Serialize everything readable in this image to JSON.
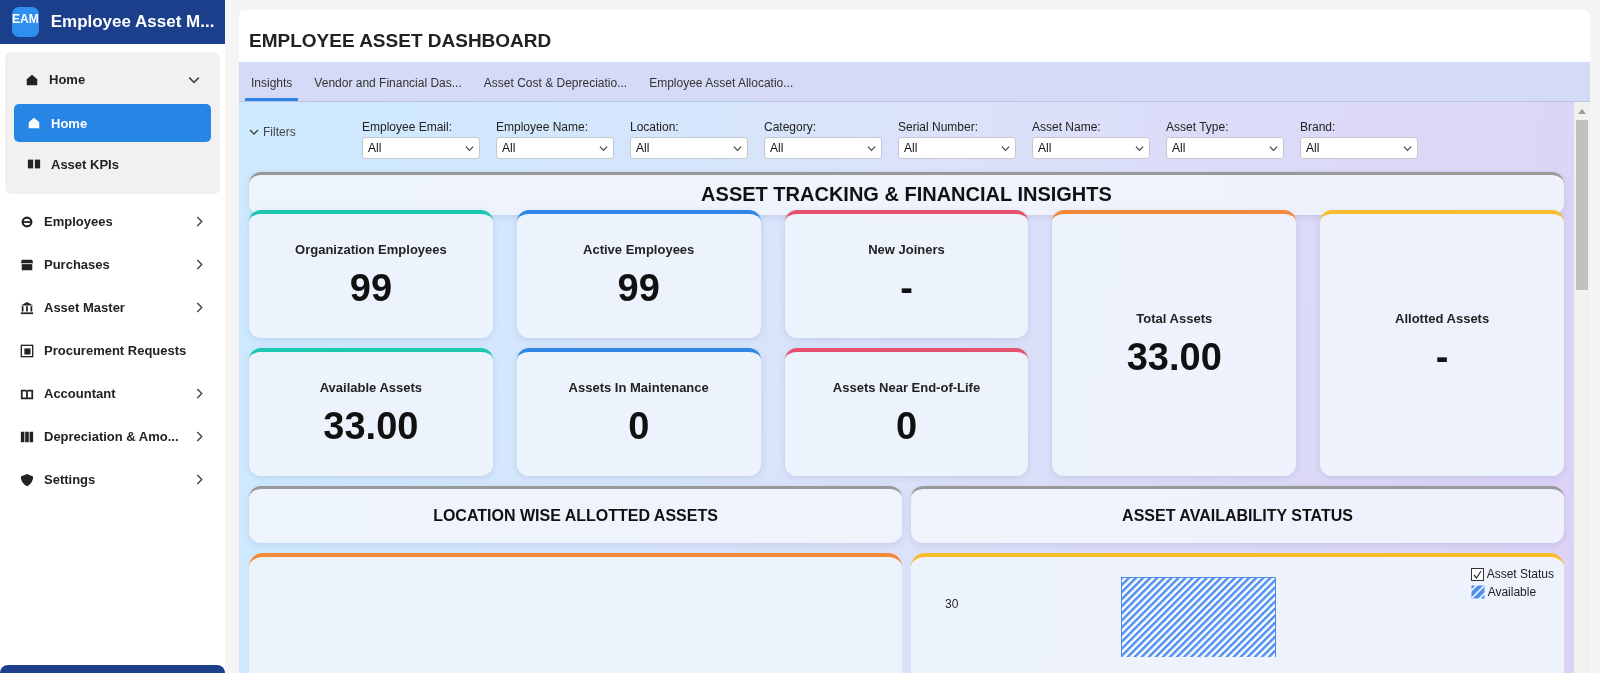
{
  "app": {
    "logo": "EAM",
    "title": "Employee Asset M..."
  },
  "sidebar": {
    "items": [
      {
        "label": "Home",
        "expanded": true,
        "children": [
          {
            "label": "Home",
            "selected": true
          },
          {
            "label": "Asset KPIs",
            "selected": false
          }
        ]
      },
      {
        "label": "Employees",
        "expanded": false
      },
      {
        "label": "Purchases",
        "expanded": false
      },
      {
        "label": "Asset Master",
        "expanded": false
      },
      {
        "label": "Procurement Requests"
      },
      {
        "label": "Accountant",
        "expanded": false
      },
      {
        "label": "Depreciation & Amo...",
        "expanded": false
      },
      {
        "label": "Settings",
        "expanded": false
      }
    ]
  },
  "page": {
    "title": "EMPLOYEE ASSET DASHBOARD"
  },
  "tabs": [
    {
      "label": "Insights",
      "selected": true
    },
    {
      "label": "Vendor and Financial Das...",
      "selected": false
    },
    {
      "label": "Asset Cost & Depreciatio...",
      "selected": false
    },
    {
      "label": "Employee Asset Allocatio...",
      "selected": false
    }
  ],
  "filters": {
    "toggle": "Filters",
    "expanded": true,
    "fields": [
      {
        "label": "Employee Email:",
        "value": "All"
      },
      {
        "label": "Employee Name:",
        "value": "All"
      },
      {
        "label": "Location:",
        "value": "All"
      },
      {
        "label": "Category:",
        "value": "All"
      },
      {
        "label": "Serial Number:",
        "value": "All"
      },
      {
        "label": "Asset Name:",
        "value": "All"
      },
      {
        "label": "Asset Type:",
        "value": "All"
      },
      {
        "label": "Brand:",
        "value": "All"
      }
    ]
  },
  "insights": {
    "title": "ASSET TRACKING & FINANCIAL INSIGHTS",
    "cards": [
      {
        "kind": "small",
        "label": "Organization Employees",
        "value": "99",
        "color": "#1cc7b0"
      },
      {
        "kind": "small",
        "label": "Active Employees",
        "value": "99",
        "color": "#2f86e6"
      },
      {
        "kind": "small",
        "label": "New Joiners",
        "value": "-",
        "color": "#e4506e"
      },
      {
        "kind": "tall",
        "label": "Total Assets",
        "value": "33.00",
        "color": "#f5893a"
      },
      {
        "kind": "tall",
        "label": "Allotted Assets",
        "value": "-",
        "color": "#f7bd2a"
      },
      {
        "kind": "small",
        "label": "Available Assets",
        "value": "33.00",
        "color": "#1cc7b0"
      },
      {
        "kind": "small",
        "label": "Assets In Maintenance",
        "value": "0",
        "color": "#2f86e6"
      },
      {
        "kind": "small",
        "label": "Assets Near End-of-Life",
        "value": "0",
        "color": "#e4506e"
      }
    ]
  },
  "sections": [
    {
      "title": "LOCATION WISE ALLOTTED ASSETS",
      "color": "#f5893a"
    },
    {
      "title": "ASSET AVAILABILITY STATUS",
      "color": "#f7bd2a",
      "y_tick": "30",
      "legend": {
        "title": "Asset Status",
        "checked": true,
        "items": [
          {
            "label": "Available",
            "color": "#4d8ff0"
          }
        ]
      }
    }
  ]
}
